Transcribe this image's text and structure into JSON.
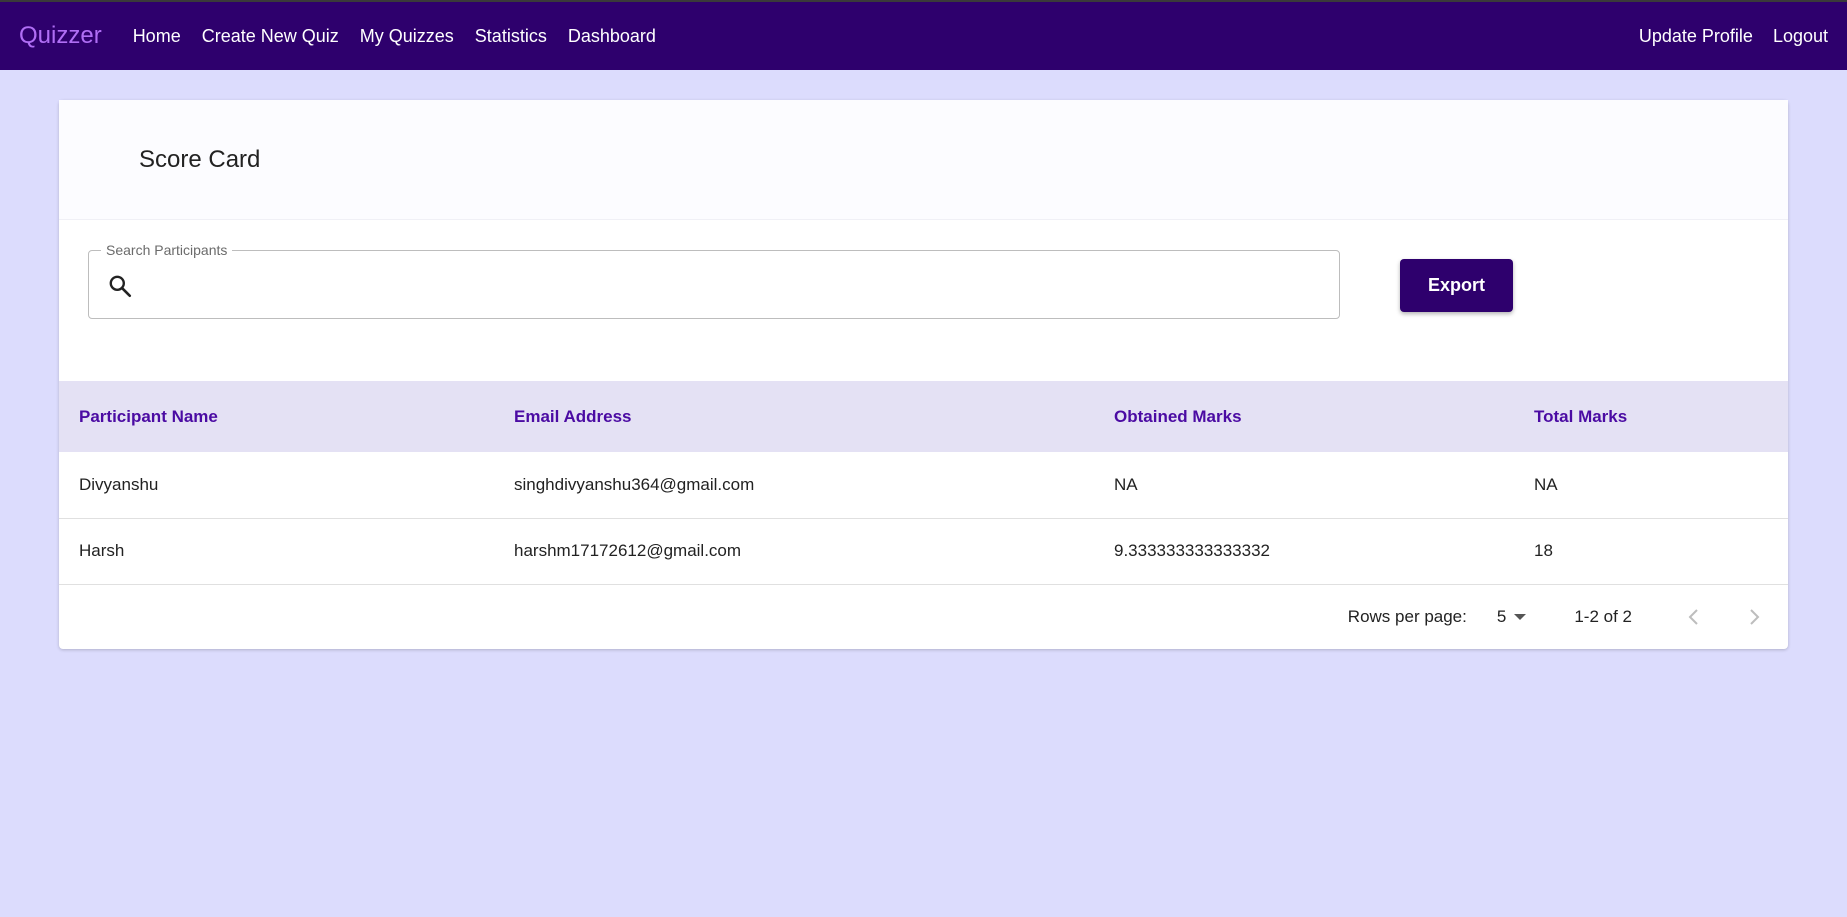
{
  "navbar": {
    "brand": "Quizzer",
    "links": [
      "Home",
      "Create New Quiz",
      "My Quizzes",
      "Statistics",
      "Dashboard"
    ],
    "right_links": [
      "Update Profile",
      "Logout"
    ]
  },
  "page": {
    "title": "Score Card"
  },
  "search": {
    "label": "Search Participants",
    "value": "",
    "placeholder": ""
  },
  "toolbar": {
    "export_label": "Export"
  },
  "table": {
    "headers": [
      "Participant Name",
      "Email Address",
      "Obtained Marks",
      "Total Marks"
    ],
    "rows": [
      [
        "Divyanshu",
        "singhdivyanshu364@gmail.com",
        "NA",
        "NA"
      ],
      [
        "Harsh",
        "harshm17172612@gmail.com",
        "9.333333333333332",
        "18"
      ]
    ]
  },
  "pagination": {
    "rows_per_page_label": "Rows per page:",
    "rows_per_page": "5",
    "range": "1-2 of 2"
  },
  "colors": {
    "navbar_bg": "#2e006d",
    "brand": "#b06ef5",
    "page_bg": "#dcdcfd",
    "header_text": "#4b0ba3",
    "header_bg": "#e4e1f4"
  }
}
